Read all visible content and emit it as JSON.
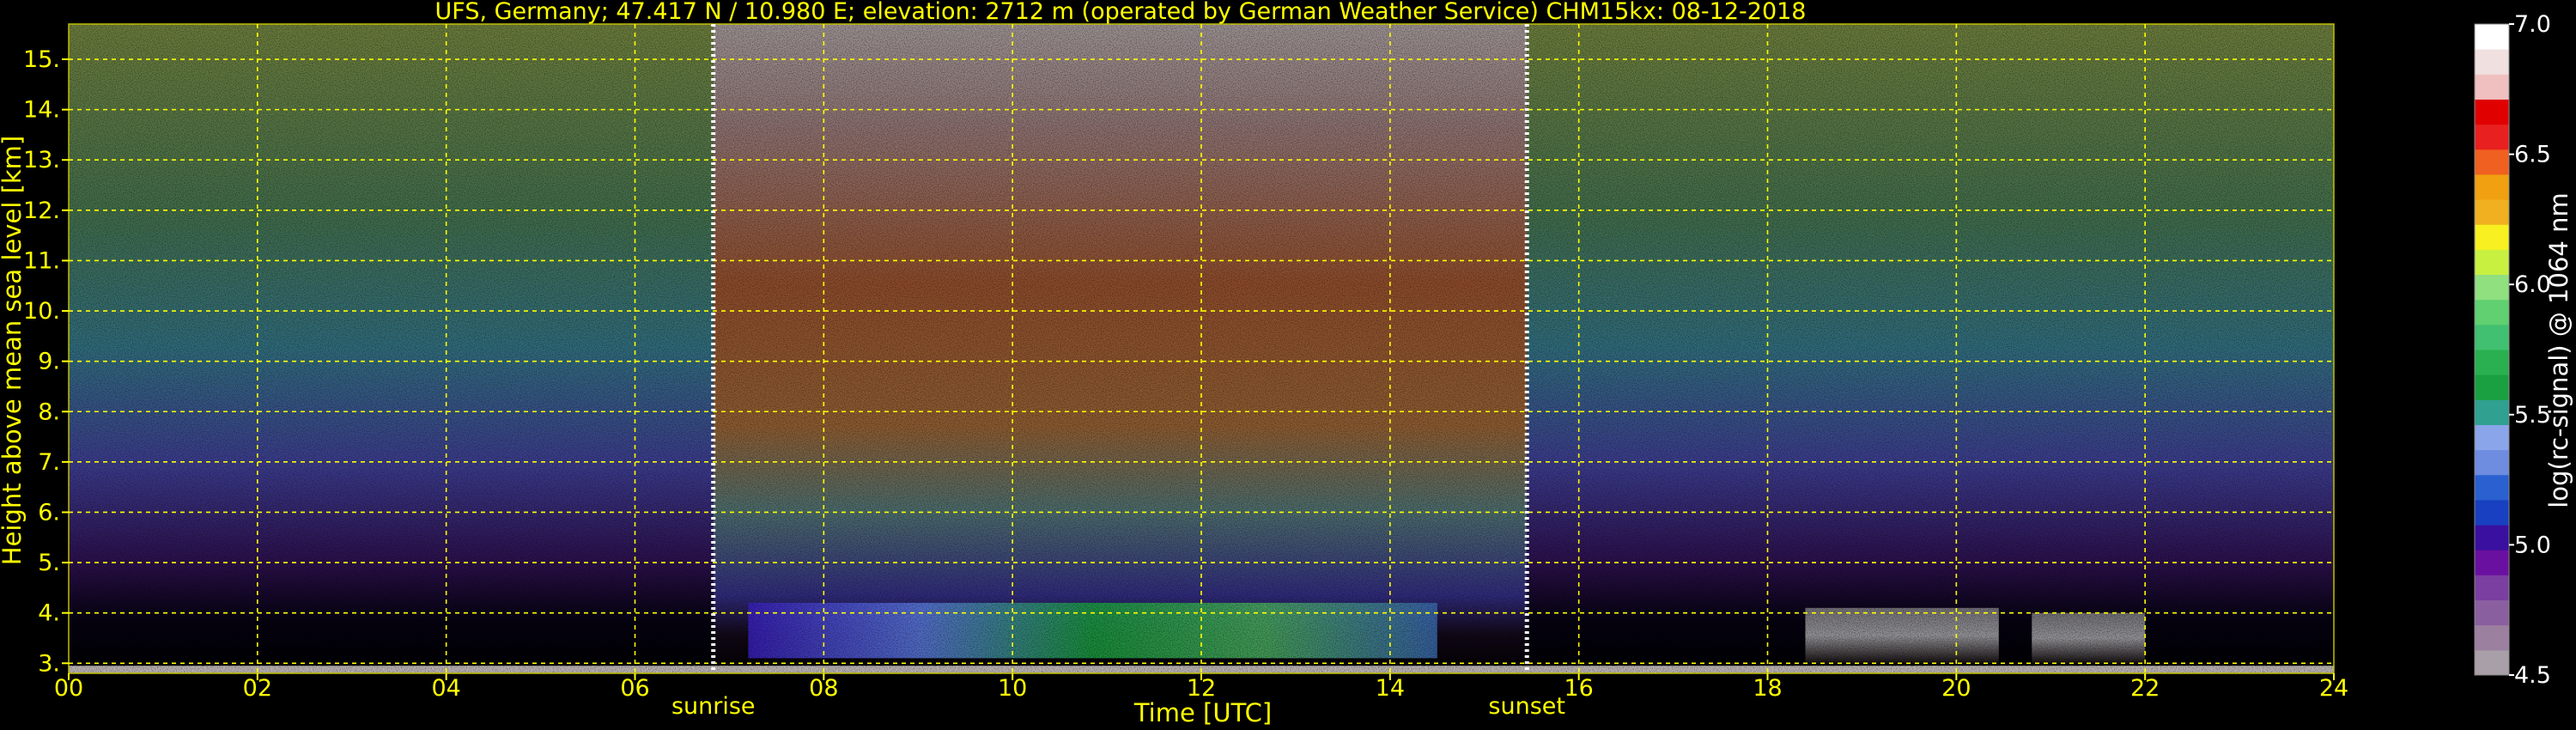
{
  "chart_data": {
    "type": "heatmap",
    "title": "UFS, Germany; 47.417 N / 10.980 E; elevation: 2712 m  (operated by German Weather Service)    CHM15kx: 08-12-2018",
    "xlabel": "Time [UTC]",
    "ylabel": "Height above mean sea level [km]",
    "xlim": [
      0,
      24
    ],
    "ylim": [
      2.8,
      15.7
    ],
    "x_ticks": [
      0,
      2,
      4,
      6,
      8,
      10,
      12,
      14,
      16,
      18,
      20,
      22,
      24
    ],
    "x_tick_labels": [
      "00",
      "02",
      "04",
      "06",
      "08",
      "10",
      "12",
      "14",
      "16",
      "18",
      "20",
      "22",
      "24"
    ],
    "y_ticks": [
      3,
      4,
      5,
      6,
      7,
      8,
      9,
      10,
      11,
      12,
      13,
      14,
      15
    ],
    "y_tick_labels": [
      "3.",
      "4.",
      "5.",
      "6.",
      "7.",
      "8.",
      "9.",
      "10.",
      "11.",
      "12.",
      "13.",
      "14.",
      "15."
    ],
    "grid": true,
    "grid_color": "#ffff00",
    "markers": [
      {
        "label": "sunrise",
        "x": 6.83
      },
      {
        "label": "sunset",
        "x": 15.45
      }
    ],
    "cloud_layer": {
      "x_start": 7.2,
      "x_end": 14.5,
      "bottom_km": 3.1,
      "top_km": 4.2
    },
    "evening_clouds": [
      {
        "x_start": 18.4,
        "x_end": 20.45,
        "top_km": 4.1
      },
      {
        "x_start": 20.8,
        "x_end": 22.0,
        "top_km": 4.0
      }
    ],
    "colorbar": {
      "label": "log(rc-signal) @ 1064 nm",
      "range": [
        4.5,
        7.0
      ],
      "ticks": [
        4.5,
        5.0,
        5.5,
        6.0,
        6.5,
        7.0
      ],
      "tick_labels": [
        "4.5",
        "5.0",
        "5.5",
        "6.0",
        "6.5",
        "7.0"
      ],
      "colors": [
        "#a89fa8",
        "#9b80a0",
        "#8a5fa0",
        "#7a3fa0",
        "#6a10a0",
        "#3a10a0",
        "#1840c0",
        "#2a60d0",
        "#6e8ce0",
        "#8aa5ea",
        "#30a090",
        "#1aa040",
        "#2ab050",
        "#40c070",
        "#60d070",
        "#90e080",
        "#c8f040",
        "#f8f020",
        "#f0b020",
        "#f0a010",
        "#f06020",
        "#e82020",
        "#e00000",
        "#f0c0c0",
        "#f0e0e0",
        "#ffffff"
      ]
    }
  }
}
